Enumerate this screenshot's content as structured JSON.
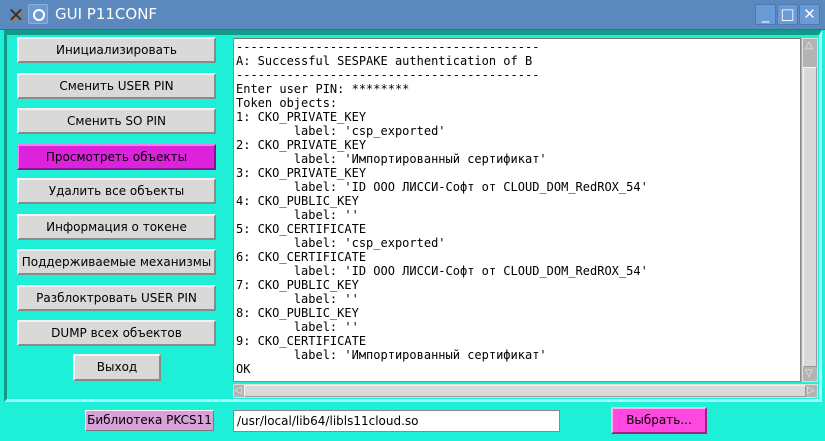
{
  "window": {
    "title": "GUI P11CONF"
  },
  "buttons": [
    {
      "label": "Инициализировать"
    },
    {
      "label": "Сменить USER PIN"
    },
    {
      "label": "Сменить SO PIN"
    },
    {
      "label": "Просмотреть объекты",
      "active": true
    },
    {
      "label": "Удалить все объекты"
    },
    {
      "label": "Информация о токене"
    },
    {
      "label": "Поддерживаемые механизмы"
    },
    {
      "label": "Разблоктровать USER PIN"
    },
    {
      "label": "DUMP всех объектов"
    }
  ],
  "exit_label": "Выход",
  "output": {
    "lines": [
      "------------------------------------------",
      "A: Successful SESPAKE authentication of B",
      "------------------------------------------",
      "Enter user PIN: ********",
      "Token objects:",
      "1: CKO_PRIVATE_KEY",
      "        label: 'csp_exported'",
      "2: CKO_PRIVATE_KEY",
      "        label: 'Импортированный сертификат'",
      "3: CKO_PRIVATE_KEY",
      "        label: 'ID ООО ЛИССИ-Софт от CLOUD_DOM_RedROX_54'",
      "4: CKO_PUBLIC_KEY",
      "        label: ''",
      "5: CKO_CERTIFICATE",
      "        label: 'csp_exported'",
      "6: CKO_CERTIFICATE",
      "        label: 'ID ООО ЛИССИ-Софт от CLOUD_DOM_RedROX_54'",
      "7: CKO_PUBLIC_KEY",
      "        label: ''",
      "8: CKO_PUBLIC_KEY",
      "        label: ''",
      "9: CKO_CERTIFICATE",
      "        label: 'Импортированный сертификат'",
      "OK"
    ]
  },
  "library": {
    "label": "Библиотека PKCS11",
    "path": "/usr/local/lib64/libls11cloud.so",
    "choose_label": "Выбрать..."
  }
}
